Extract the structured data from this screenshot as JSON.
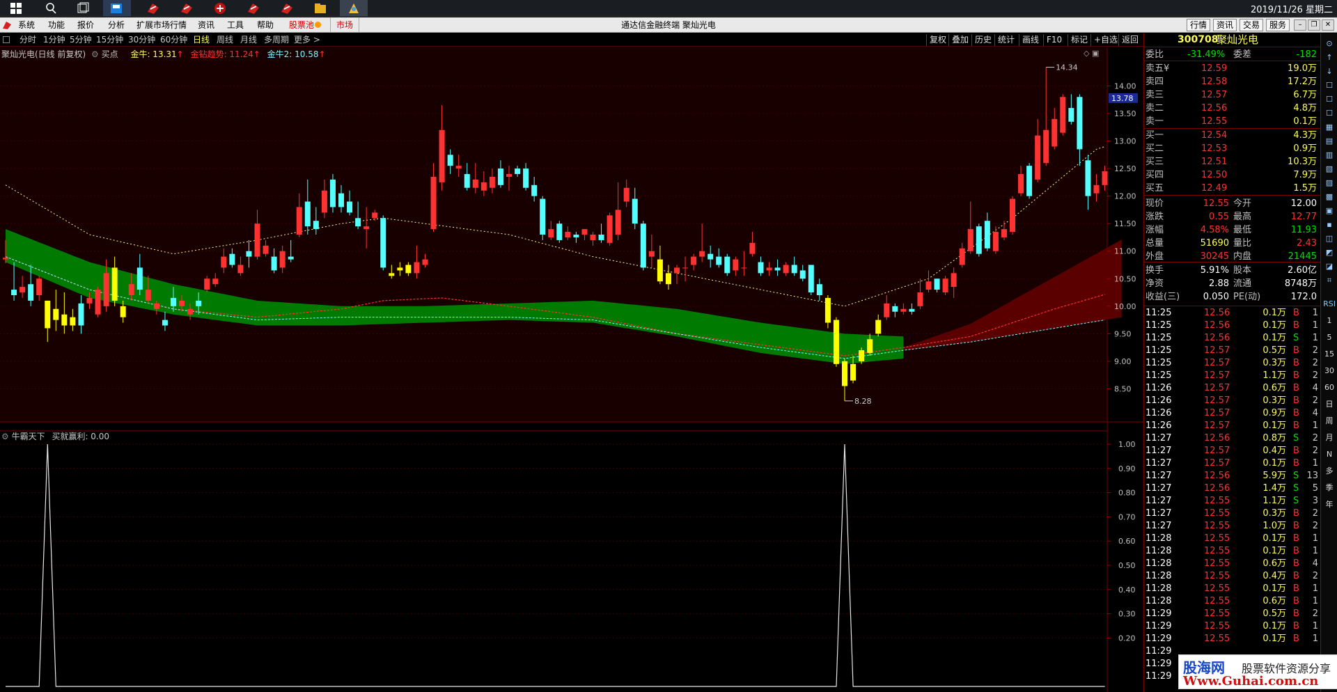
{
  "taskbar": {
    "clock": "2019/11/26 星期二",
    "icons": [
      "windows-start-icon",
      "search-icon",
      "task-view-icon",
      "file-explorer-icon",
      "app-icon",
      "app-icon",
      "app-icon",
      "app-icon",
      "app-icon",
      "app-icon",
      "app-icon"
    ]
  },
  "menubar": {
    "items": [
      "系统",
      "功能",
      "报价",
      "分析",
      "扩展市场行情",
      "资讯",
      "工具",
      "帮助",
      "股票池",
      "市场"
    ],
    "title": "通达信金融终端  聚灿光电",
    "right_buttons": [
      "行情",
      "资讯",
      "交易",
      "服务"
    ]
  },
  "periods": {
    "items": [
      "分时",
      "1分钟",
      "5分钟",
      "15分钟",
      "30分钟",
      "60分钟",
      "日线",
      "周线",
      "月线",
      "多周期",
      "更多 >"
    ],
    "active": "日线"
  },
  "toolbar": [
    "复权",
    "叠加",
    "历史",
    "统计",
    "画线",
    "F10",
    "标记",
    "+自选",
    "返回"
  ],
  "legend": {
    "name": "聚灿光电(日线 前复权)",
    "mark": "买点",
    "items": [
      {
        "label": "金牛: 13.31",
        "color": "#ffff54"
      },
      {
        "label": "金钻趋势: 11.24",
        "color": "#ff3030"
      },
      {
        "label": "金牛2: 10.58",
        "color": "#7cf6ff"
      }
    ]
  },
  "indicator": {
    "name": "牛霸天下",
    "value": "买就赢利: 0.00"
  },
  "price_axis": [
    "14.00",
    "13.50",
    "13.00",
    "12.50",
    "12.00",
    "11.50",
    "11.00",
    "10.50",
    "10.00",
    "9.50",
    "9.00",
    "8.50"
  ],
  "price_tag": "13.78",
  "ind_axis": [
    "1.00",
    "0.90",
    "0.80",
    "0.70",
    "0.60",
    "0.50",
    "0.40",
    "0.30",
    "0.20"
  ],
  "hi_label": "14.34",
  "lo_label": "8.28",
  "quote": {
    "code": "300708",
    "name": "聚灿光电",
    "ratio": {
      "l1": "委比",
      "v1": "-31.49%",
      "l2": "委差",
      "v2": "-182"
    },
    "sells": [
      {
        "l": "卖五",
        "p": "12.59",
        "v": "19.0万",
        "m": "¥"
      },
      {
        "l": "卖四",
        "p": "12.58",
        "v": "17.2万"
      },
      {
        "l": "卖三",
        "p": "12.57",
        "v": "6.7万"
      },
      {
        "l": "卖二",
        "p": "12.56",
        "v": "4.8万"
      },
      {
        "l": "卖一",
        "p": "12.55",
        "v": "0.1万"
      }
    ],
    "buys": [
      {
        "l": "买一",
        "p": "12.54",
        "v": "4.3万"
      },
      {
        "l": "买二",
        "p": "12.53",
        "v": "0.9万"
      },
      {
        "l": "买三",
        "p": "12.51",
        "v": "10.3万"
      },
      {
        "l": "买四",
        "p": "12.50",
        "v": "7.9万"
      },
      {
        "l": "买五",
        "p": "12.49",
        "v": "1.5万"
      }
    ],
    "stats1": [
      {
        "l1": "现价",
        "v1": "12.55",
        "l2": "今开",
        "v2": "12.00"
      },
      {
        "l1": "涨跌",
        "v1": "0.55",
        "l2": "最高",
        "v2": "12.77"
      },
      {
        "l1": "涨幅",
        "v1": "4.58%",
        "l2": "最低",
        "v2": "11.93"
      },
      {
        "l1": "总量",
        "v1": "51690",
        "l2": "量比",
        "v2": "2.43"
      },
      {
        "l1": "外盘",
        "v1": "30245",
        "l2": "内盘",
        "v2": "21445"
      }
    ],
    "stats2": [
      {
        "l1": "换手",
        "v1": "5.91%",
        "l2": "股本",
        "v2": "2.60亿"
      },
      {
        "l1": "净资",
        "v1": "2.88",
        "l2": "流通",
        "v2": "8748万"
      },
      {
        "l1": "收益(三)",
        "v1": "0.050",
        "l2": "PE(动)",
        "v2": "172.0"
      }
    ]
  },
  "ticks": [
    [
      "11:25",
      "12.56",
      "0.1万",
      "B",
      "1"
    ],
    [
      "11:25",
      "12.56",
      "0.1万",
      "B",
      "1"
    ],
    [
      "11:25",
      "12.56",
      "0.1万",
      "S",
      "1"
    ],
    [
      "11:25",
      "12.57",
      "0.5万",
      "B",
      "2"
    ],
    [
      "11:25",
      "12.57",
      "0.3万",
      "B",
      "2"
    ],
    [
      "11:25",
      "12.57",
      "1.1万",
      "B",
      "2"
    ],
    [
      "11:26",
      "12.57",
      "0.6万",
      "B",
      "4"
    ],
    [
      "11:26",
      "12.57",
      "0.3万",
      "B",
      "2"
    ],
    [
      "11:26",
      "12.57",
      "0.9万",
      "B",
      "4"
    ],
    [
      "11:26",
      "12.57",
      "0.1万",
      "B",
      "1"
    ],
    [
      "11:27",
      "12.56",
      "0.8万",
      "S",
      "2"
    ],
    [
      "11:27",
      "12.57",
      "0.4万",
      "B",
      "2"
    ],
    [
      "11:27",
      "12.57",
      "0.1万",
      "B",
      "1"
    ],
    [
      "11:27",
      "12.56",
      "5.9万",
      "S",
      "13"
    ],
    [
      "11:27",
      "12.56",
      "1.4万",
      "S",
      "5"
    ],
    [
      "11:27",
      "12.55",
      "1.1万",
      "S",
      "3"
    ],
    [
      "11:27",
      "12.55",
      "0.3万",
      "B",
      "2"
    ],
    [
      "11:27",
      "12.55",
      "1.0万",
      "B",
      "2"
    ],
    [
      "11:28",
      "12.55",
      "0.1万",
      "B",
      "1"
    ],
    [
      "11:28",
      "12.55",
      "0.1万",
      "B",
      "1"
    ],
    [
      "11:28",
      "12.55",
      "0.6万",
      "B",
      "4"
    ],
    [
      "11:28",
      "12.55",
      "0.4万",
      "B",
      "2"
    ],
    [
      "11:28",
      "12.55",
      "0.1万",
      "B",
      "1"
    ],
    [
      "11:28",
      "12.55",
      "0.6万",
      "B",
      "1"
    ],
    [
      "11:29",
      "12.55",
      "0.5万",
      "B",
      "2"
    ],
    [
      "11:29",
      "12.55",
      "0.1万",
      "B",
      "1"
    ],
    [
      "11:29",
      "12.55",
      "0.1万",
      "B",
      "1"
    ],
    [
      "11:29",
      "",
      "",
      "",
      ""
    ],
    [
      "11:29",
      "",
      "",
      "",
      ""
    ],
    [
      "11:29",
      "",
      "",
      "",
      ""
    ]
  ],
  "sidebar": [
    "RSI",
    "1",
    "5",
    "15",
    "30",
    "60",
    "日",
    "周",
    "月",
    "N",
    "多",
    "季",
    "年"
  ],
  "watermark": {
    "name": "股海网",
    "tag": "股票软件资源分享",
    "url": "Www.Guhai.com.cn"
  },
  "colors": {
    "up": "#ff3232",
    "down": "#54ffff",
    "bull_band": "#007a00",
    "bear_band": "#5a0000",
    "bg_main": "#180000",
    "gold": "#ffff00"
  },
  "chart_data": {
    "type": "candlestick",
    "ylim": [
      8.0,
      14.6
    ],
    "candles": [
      [
        10.85,
        10.88,
        10.78,
        11.2
      ],
      [
        10.3,
        10.2,
        10.1,
        10.8
      ],
      [
        10.25,
        10.35,
        10.15,
        10.55
      ],
      [
        10.4,
        10.1,
        10.0,
        10.75
      ],
      [
        10.2,
        10.5,
        10.1,
        10.55
      ],
      [
        10.1,
        9.6,
        9.35,
        10.1
      ],
      [
        9.95,
        9.75,
        9.55,
        10.3
      ],
      [
        9.85,
        9.65,
        9.5,
        10.25
      ],
      [
        9.8,
        9.65,
        9.55,
        9.95
      ],
      [
        10.05,
        9.65,
        9.5,
        10.2
      ],
      [
        10.05,
        10.15,
        9.95,
        10.25
      ],
      [
        9.85,
        10.3,
        9.8,
        10.35
      ],
      [
        10.0,
        10.6,
        9.9,
        10.85
      ],
      [
        10.1,
        10.7,
        10.0,
        10.9
      ],
      [
        10.0,
        9.8,
        9.7,
        10.1
      ],
      [
        10.2,
        10.4,
        10.1,
        10.6
      ],
      [
        10.7,
        10.3,
        10.2,
        10.95
      ],
      [
        10.1,
        10.3,
        10.05,
        10.55
      ],
      [
        9.95,
        10.05,
        9.85,
        10.1
      ],
      [
        9.75,
        9.65,
        9.55,
        9.9
      ],
      [
        10.15,
        10.0,
        9.9,
        10.35
      ],
      [
        10.0,
        10.1,
        9.9,
        10.2
      ],
      [
        9.85,
        9.95,
        9.75,
        10.05
      ],
      [
        10.1,
        10.0,
        9.85,
        10.25
      ],
      [
        10.3,
        10.5,
        10.25,
        10.55
      ],
      [
        10.4,
        10.5,
        10.35,
        10.6
      ],
      [
        10.7,
        10.9,
        10.6,
        11.05
      ],
      [
        10.95,
        10.75,
        10.7,
        11.05
      ],
      [
        10.6,
        10.75,
        10.55,
        10.9
      ],
      [
        11.0,
        10.9,
        10.7,
        11.2
      ],
      [
        10.9,
        11.5,
        10.85,
        11.75
      ],
      [
        10.95,
        11.1,
        10.9,
        11.2
      ],
      [
        10.9,
        10.65,
        10.6,
        11.05
      ],
      [
        10.7,
        11.0,
        10.6,
        11.1
      ],
      [
        10.9,
        10.85,
        10.8,
        11.2
      ],
      [
        11.3,
        11.8,
        11.25,
        12.05
      ],
      [
        11.9,
        11.45,
        11.3,
        12.3
      ],
      [
        11.55,
        11.4,
        11.3,
        11.8
      ],
      [
        11.7,
        12.1,
        11.6,
        12.3
      ],
      [
        12.3,
        11.8,
        11.7,
        12.4
      ],
      [
        12.05,
        11.8,
        11.7,
        12.2
      ],
      [
        11.9,
        11.7,
        11.65,
        12.1
      ],
      [
        11.6,
        11.45,
        11.4,
        11.9
      ],
      [
        11.4,
        11.45,
        11.05,
        11.8
      ],
      [
        11.6,
        11.7,
        11.55,
        11.75
      ],
      [
        11.6,
        10.7,
        10.65,
        11.65
      ],
      [
        10.55,
        10.6,
        10.5,
        10.75
      ],
      [
        10.7,
        10.65,
        10.55,
        10.8
      ],
      [
        10.6,
        10.75,
        10.55,
        10.8
      ],
      [
        10.6,
        10.8,
        10.5,
        11.1
      ],
      [
        10.75,
        10.85,
        10.7,
        10.95
      ],
      [
        11.4,
        12.35,
        11.35,
        12.6
      ],
      [
        12.25,
        13.2,
        12.1,
        13.65
      ],
      [
        12.75,
        12.55,
        12.4,
        12.85
      ],
      [
        12.5,
        12.55,
        12.35,
        12.75
      ],
      [
        12.4,
        12.15,
        12.1,
        12.6
      ],
      [
        12.15,
        12.3,
        12.05,
        12.6
      ],
      [
        12.1,
        12.25,
        12.0,
        12.45
      ],
      [
        12.15,
        12.35,
        12.05,
        12.5
      ],
      [
        12.5,
        12.2,
        12.15,
        12.65
      ],
      [
        12.35,
        12.4,
        12.1,
        12.55
      ],
      [
        12.5,
        12.4,
        12.35,
        12.55
      ],
      [
        12.5,
        12.15,
        12.1,
        12.6
      ],
      [
        12.2,
        12.0,
        11.9,
        12.35
      ],
      [
        11.95,
        11.3,
        11.2,
        12.0
      ],
      [
        11.25,
        11.4,
        11.2,
        11.55
      ],
      [
        11.5,
        11.2,
        11.15,
        11.55
      ],
      [
        11.25,
        11.35,
        11.2,
        11.45
      ],
      [
        11.3,
        11.25,
        11.15,
        11.35
      ],
      [
        11.3,
        11.4,
        11.2,
        11.4
      ],
      [
        11.2,
        11.3,
        11.1,
        11.35
      ],
      [
        11.3,
        11.2,
        11.15,
        11.5
      ],
      [
        11.15,
        11.65,
        11.1,
        11.7
      ],
      [
        11.3,
        11.75,
        11.2,
        12.25
      ],
      [
        11.9,
        12.15,
        11.8,
        12.3
      ],
      [
        11.95,
        11.5,
        11.4,
        12.15
      ],
      [
        11.5,
        10.7,
        10.65,
        11.55
      ],
      [
        10.9,
        11.0,
        10.7,
        11.3
      ],
      [
        10.85,
        10.45,
        10.4,
        11.1
      ],
      [
        10.6,
        10.4,
        10.3,
        10.75
      ],
      [
        10.6,
        10.7,
        10.4,
        10.75
      ],
      [
        10.7,
        10.7,
        10.45,
        10.9
      ],
      [
        10.75,
        10.9,
        10.65,
        10.95
      ],
      [
        10.9,
        11.0,
        10.8,
        11.5
      ],
      [
        10.95,
        10.85,
        10.7,
        11.1
      ],
      [
        10.9,
        10.75,
        10.7,
        11.05
      ],
      [
        10.9,
        10.6,
        10.55,
        10.95
      ],
      [
        10.65,
        10.85,
        10.55,
        10.9
      ],
      [
        10.7,
        10.7,
        10.55,
        11.0
      ],
      [
        10.95,
        11.15,
        10.9,
        11.35
      ],
      [
        10.8,
        10.6,
        10.55,
        10.9
      ],
      [
        10.65,
        10.7,
        10.55,
        10.8
      ],
      [
        10.7,
        10.65,
        10.55,
        10.85
      ],
      [
        10.6,
        10.75,
        10.55,
        10.8
      ],
      [
        10.75,
        10.6,
        10.55,
        10.9
      ],
      [
        10.65,
        10.5,
        10.45,
        10.75
      ],
      [
        10.75,
        10.25,
        10.2,
        10.75
      ],
      [
        10.4,
        10.2,
        10.1,
        10.5
      ],
      [
        10.15,
        9.7,
        9.6,
        10.2
      ],
      [
        9.75,
        8.95,
        8.9,
        9.8
      ],
      [
        9.0,
        8.55,
        8.28,
        9.05
      ],
      [
        8.65,
        8.95,
        8.6,
        9.1
      ],
      [
        9.0,
        9.2,
        8.95,
        9.25
      ],
      [
        9.15,
        9.4,
        9.1,
        9.5
      ],
      [
        9.5,
        9.75,
        9.45,
        9.85
      ],
      [
        9.8,
        10.05,
        9.75,
        10.2
      ],
      [
        10.0,
        9.9,
        9.8,
        10.05
      ],
      [
        9.9,
        9.95,
        9.85,
        10.05
      ],
      [
        9.95,
        9.9,
        9.85,
        10.05
      ],
      [
        10.0,
        10.25,
        9.95,
        10.5
      ],
      [
        10.3,
        10.45,
        10.25,
        10.65
      ],
      [
        10.5,
        10.3,
        10.25,
        10.5
      ],
      [
        10.25,
        10.5,
        10.2,
        10.55
      ],
      [
        10.35,
        10.6,
        10.15,
        10.7
      ],
      [
        10.75,
        11.05,
        10.7,
        11.15
      ],
      [
        11.0,
        11.4,
        10.95,
        11.9
      ],
      [
        11.45,
        10.95,
        10.9,
        11.5
      ],
      [
        11.55,
        11.05,
        11.0,
        11.7
      ],
      [
        11.0,
        11.35,
        10.95,
        11.45
      ],
      [
        11.25,
        11.4,
        11.2,
        11.55
      ],
      [
        11.35,
        11.95,
        11.3,
        12.0
      ],
      [
        12.05,
        12.4,
        12.0,
        12.55
      ],
      [
        12.55,
        12.0,
        11.95,
        12.6
      ],
      [
        12.3,
        13.1,
        12.25,
        13.4
      ],
      [
        12.6,
        13.2,
        12.55,
        14.34
      ],
      [
        12.9,
        13.4,
        12.85,
        13.6
      ],
      [
        13.15,
        13.8,
        13.1,
        13.85
      ],
      [
        13.6,
        13.35,
        13.3,
        13.85
      ],
      [
        13.8,
        12.85,
        12.55,
        13.85
      ],
      [
        12.65,
        12.0,
        11.75,
        12.75
      ],
      [
        12.05,
        12.2,
        11.9,
        12.4
      ],
      [
        12.2,
        12.45,
        12.1,
        12.55
      ]
    ]
  }
}
